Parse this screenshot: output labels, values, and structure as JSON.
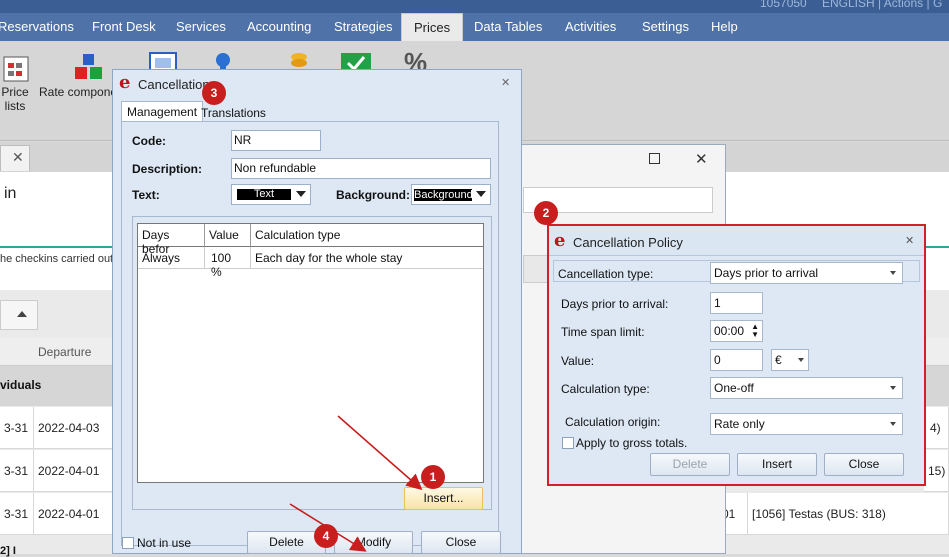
{
  "top_strip": {
    "left_text": "1057050",
    "right_text": "ENGLISH | Actions | G"
  },
  "menu": {
    "items": [
      "Reservations",
      "Front Desk",
      "Services",
      "Accounting",
      "Strategies",
      "Prices",
      "Data Tables",
      "Activities",
      "Settings",
      "Help"
    ],
    "active": "Prices"
  },
  "ribbon": {
    "price_lists_label": "Price lists",
    "rate_components_label": "Rate compone"
  },
  "background": {
    "page_heading": "in",
    "checkins_text": "he checkins carried out",
    "departure_header": "Departure",
    "group_row_label": "viduals",
    "rows": [
      {
        "arrival": "3-31",
        "departure": "2022-04-03",
        "right": "4)"
      },
      {
        "arrival": "3-31",
        "departure": "2022-04-01",
        "right": "15)"
      },
      {
        "arrival": "3-31",
        "departure": "2022-04-01",
        "middle": "01",
        "right": "[1056] Testas (BUS: 318)"
      }
    ],
    "bottom_left_text": "2] I"
  },
  "cancellation_dialog": {
    "title": "Cancellation",
    "tabs": [
      "Management",
      "Translations"
    ],
    "code_label": "Code:",
    "code_value": "NR",
    "description_label": "Description:",
    "description_value": "Non refundable",
    "text_label": "Text:",
    "text_value": "Text",
    "background_label": "Background:",
    "background_value": "Background",
    "grid_headers": [
      "Days befor",
      "Value",
      "Calculation type"
    ],
    "grid_rows": [
      {
        "days": "Always",
        "value": "100 %",
        "calc": "Each day for the whole stay"
      }
    ],
    "insert_button": "Insert...",
    "not_in_use_label": "Not in use",
    "delete_button": "Delete",
    "modify_button": "Modify",
    "close_button": "Close"
  },
  "policy_dialog": {
    "title": "Cancellation Policy",
    "cancellation_type_label": "Cancellation type:",
    "cancellation_type_value": "Days prior to arrival",
    "days_prior_label": "Days prior to arrival:",
    "days_prior_value": "1",
    "time_span_label": "Time span limit:",
    "time_span_value": "00:00",
    "value_label": "Value:",
    "value_value": "0",
    "currency_value": "€",
    "calc_type_label": "Calculation type:",
    "calc_type_value": "One-off",
    "calc_origin_label": "Calculation origin:",
    "calc_origin_value": "Rate only",
    "apply_gross_label": "Apply to gross totals.",
    "delete_button": "Delete",
    "insert_button": "Insert",
    "close_button": "Close"
  },
  "badges": [
    "1",
    "2",
    "3",
    "4"
  ],
  "colors": {
    "menubar": "#4f73a8",
    "highlight": "#d12027",
    "dialog_bg": "#dde8f4"
  }
}
